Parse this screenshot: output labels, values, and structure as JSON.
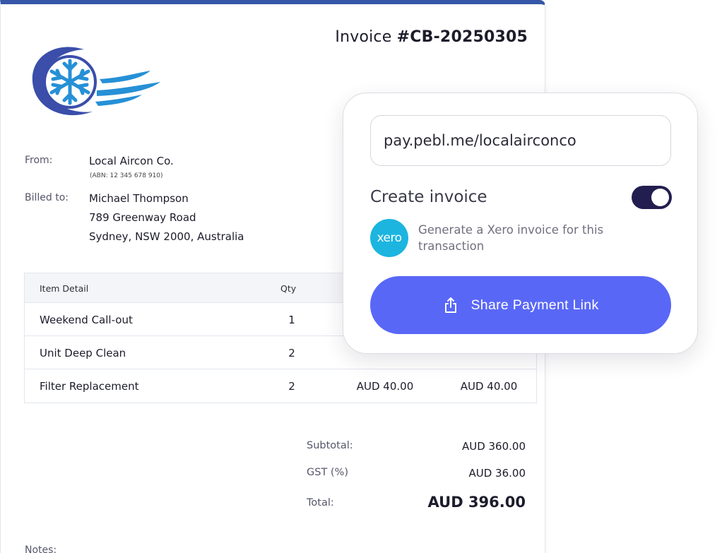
{
  "invoice": {
    "title_prefix": "Invoice ",
    "number": "#CB-20250305",
    "from_label": "From:",
    "from_name": "Local Aircon Co.",
    "from_abn": "(ABN: 12 345 678 910)",
    "billed_label": "Billed to:",
    "billed_name": "Michael Thompson",
    "billed_address_1": "789 Greenway Road",
    "billed_address_2": "Sydney, NSW 2000, Australia",
    "table": {
      "headers": {
        "item": "Item Detail",
        "qty": "Qty"
      },
      "rows": [
        {
          "item": "Weekend Call-out",
          "qty": "1",
          "price": "",
          "amount": ""
        },
        {
          "item": "Unit Deep Clean",
          "qty": "2",
          "price": "",
          "amount": ""
        },
        {
          "item": "Filter Replacement",
          "qty": "2",
          "price": "AUD 40.00",
          "amount": "AUD 40.00"
        }
      ]
    },
    "summary": {
      "subtotal_label": "Subtotal:",
      "subtotal": "AUD 360.00",
      "gst_label": "GST (%)",
      "gst": "AUD 36.00",
      "total_label": "Total:",
      "total": "AUD 396.00"
    },
    "notes_label": "Notes:"
  },
  "card": {
    "payment_url": "pay.pebl.me/localairconco",
    "create_invoice_label": "Create invoice",
    "create_invoice_enabled": true,
    "xero_logo_text": "xero",
    "xero_description": "Generate a Xero invoice for this transaction",
    "share_button_label": "Share Payment Link"
  },
  "colors": {
    "brand_blue": "#3657a8",
    "button_blue": "#5967f7",
    "toggle_dark": "#221e4f",
    "xero_blue": "#1cb5e0"
  },
  "icons": [
    "snowflake-logo",
    "share-icon"
  ]
}
